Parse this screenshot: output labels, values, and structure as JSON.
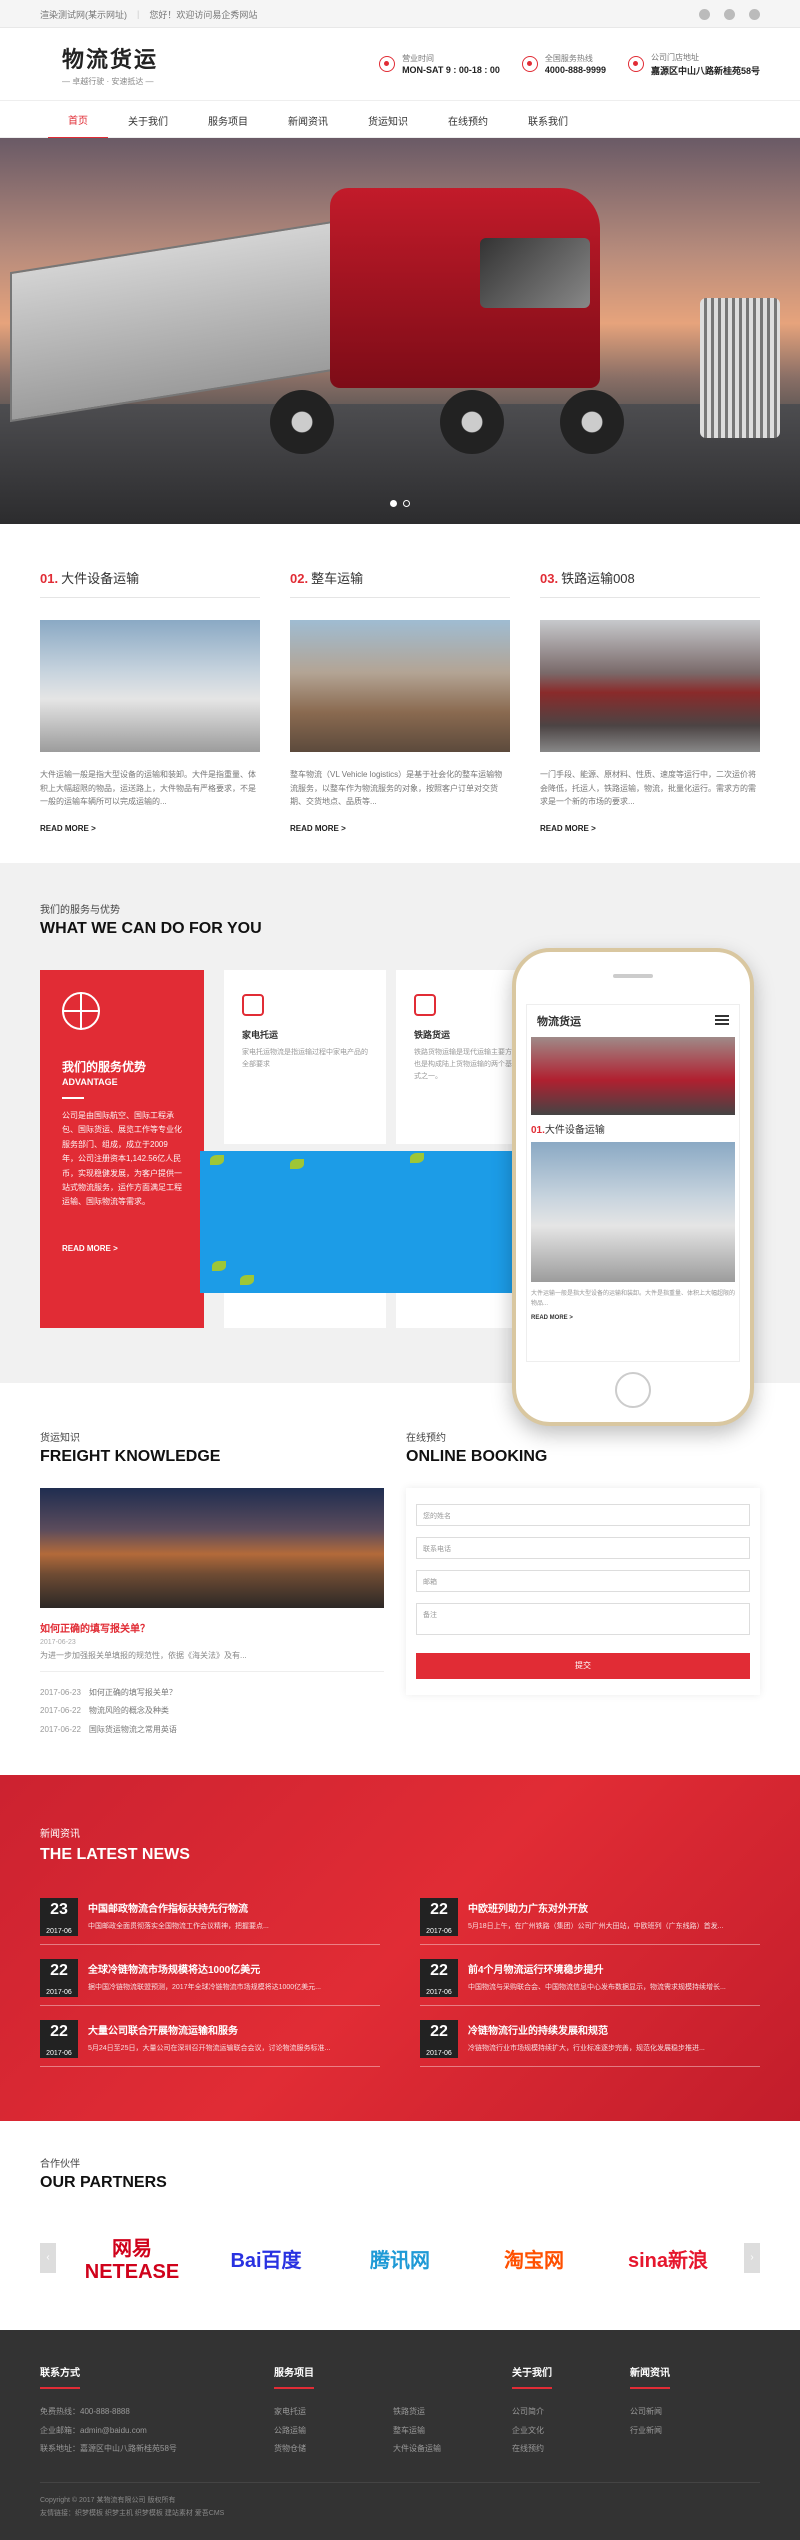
{
  "topbar": {
    "left": "渲染测试网(某示网址)",
    "welcome": "您好！欢迎访问易企秀网站"
  },
  "header": {
    "logo_name": "物流货运",
    "logo_tag": "— 卓越行驶 · 安速抵达 —",
    "hours_label": "营业时间",
    "hours_value": "MON-SAT 9 : 00-18 : 00",
    "phone_label": "全国服务热线",
    "phone_value": "4000-888-9999",
    "addr_label": "公司门店地址",
    "addr_value": "嘉源区中山八路新桂苑58号"
  },
  "nav": [
    "首页",
    "关于我们",
    "服务项目",
    "新闻资讯",
    "货运知识",
    "在线预约",
    "联系我们"
  ],
  "services": [
    {
      "num": "01.",
      "title": "大件设备运输",
      "text": "大件运输一般是指大型设备的运输和装卸。大件是指重量、体积上大幅超限的物品，运送路上，大件物品有严格要求，不是一般的运输车辆所可以完成运输的...",
      "more": "READ MORE >"
    },
    {
      "num": "02.",
      "title": "整车运输",
      "text": "整车物流（VL Vehicle logistics）是基于社会化的整车运输物流服务，以整车作为物流服务的对象，按照客户订单对交货期、交货地点、品质等...",
      "more": "READ MORE >"
    },
    {
      "num": "03.",
      "title": "铁路运输008",
      "text": "一门手段、能源、原材料、性质、速度等运行中，二次运价将会降低，托运人，铁路运输，物流，批量化运行。需求方的需求是一个新的市场的要求...",
      "more": "READ MORE >"
    }
  ],
  "what": {
    "sub": "我们的服务与优势",
    "title": "WHAT WE CAN DO FOR YOU",
    "adv_title": "我们的服务优势",
    "adv_en": "ADVANTAGE",
    "adv_text": "公司是由国际航空、国际工程承包、国际货运、展览工作等专业化服务部门、组成，成立于2009年，公司注册资本1,142.56亿人民币，实现稳健发展，为客户提供一站式物流服务，运作方面满足工程运输、国际物流等需求。",
    "adv_more": "READ MORE >",
    "cards": [
      {
        "title": "家电托运",
        "text": "家电托运物流是指运输过程中家电产品的全部要求"
      },
      {
        "title": "铁路货运",
        "text": "铁路货物运输是现代运输主要方式之一，也是构成陆上货物运输的两个基本运输方式之一。"
      }
    ]
  },
  "phone": {
    "logo": "物流货运",
    "item_num": "01.",
    "item_title": "大件设备运输",
    "item_text": "大件运输一般是指大型设备的运输和装卸。大件是指重量、体积上大幅超限的物品...",
    "more": "READ MORE >"
  },
  "knowledge": {
    "sub": "货运知识",
    "title": "FREIGHT KNOWLEDGE",
    "headline": "如何正确的填写报关单？",
    "date": "2017-06-23",
    "excerpt": "为进一步加强报关单填报的规范性，依据《海关法》及有...",
    "list": [
      {
        "date": "2017-06-23",
        "title": "如何正确的填写报关单？"
      },
      {
        "date": "2017-06-22",
        "title": "物流风险的概念及种类"
      },
      {
        "date": "2017-06-22",
        "title": "国际货运物流之常用英语"
      }
    ]
  },
  "booking": {
    "sub": "在线预约",
    "title": "ONLINE BOOKING",
    "fields": [
      "您的姓名",
      "联系电话",
      "邮箱",
      "备注"
    ],
    "submit": "提交"
  },
  "news": {
    "sub": "新闻资讯",
    "title": "THE LATEST NEWS",
    "items": [
      {
        "day": "23",
        "ym": "2017-06",
        "title": "中国邮政物流合作指标扶持先行物流",
        "text": "中国邮政全面贯彻落实全国物流工作会议精神，把握要点..."
      },
      {
        "day": "22",
        "ym": "2017-06",
        "title": "中欧班列助力广东对外开放",
        "text": "5月18日上午，在广州铁路（集团）公司广州大田站，中欧班列（广东线路）首发..."
      },
      {
        "day": "22",
        "ym": "2017-06",
        "title": "全球冷链物流市场规模将达1000亿美元",
        "text": "据中国冷链物流联盟预测，2017年全球冷链物流市场规模将达1000亿美元..."
      },
      {
        "day": "22",
        "ym": "2017-06",
        "title": "前4个月物流运行环境稳步提升",
        "text": "中国物流与采购联合会、中国物流信息中心发布数据显示，物流需求规模持续增长..."
      },
      {
        "day": "22",
        "ym": "2017-06",
        "title": "大量公司联合开展物流运输和服务",
        "text": "5月24日至25日，大量公司在深圳召开物流运输联合会议，讨论物流服务标准..."
      },
      {
        "day": "22",
        "ym": "2017-06",
        "title": "冷链物流行业的持续发展和规范",
        "text": "冷链物流行业市场规模持续扩大，行业标准逐步完善，规范化发展稳步推进..."
      }
    ]
  },
  "partners": {
    "sub": "合作伙伴",
    "title": "OUR PARTNERS",
    "logos": [
      "网易 NETEASE",
      "Bai百度",
      "腾讯网",
      "淘宝网",
      "sina新浪"
    ]
  },
  "footer": {
    "contact_title": "联系方式",
    "contact": [
      "免费热线：400-888-8888",
      "企业邮箱：admin@baidu.com",
      "联系地址：嘉源区中山八路新桂苑58号"
    ],
    "service_title": "服务项目",
    "services": [
      "家电托运",
      "铁路货运",
      "公路运输",
      "整车运输",
      "货物仓储",
      "大件设备运输"
    ],
    "about_title": "关于我们",
    "about": [
      "公司简介",
      "企业文化",
      "在线预约"
    ],
    "news_title": "新闻资讯",
    "news": [
      "公司新闻",
      "行业新闻"
    ],
    "copyright": "Copyright © 2017 某物流有限公司 版权所有",
    "links": "友情链接：织梦模板 织梦主机 织梦模板 建站素材 爱吾CMS"
  },
  "colors": {
    "accent": "#e12c35",
    "dark": "#333333"
  }
}
